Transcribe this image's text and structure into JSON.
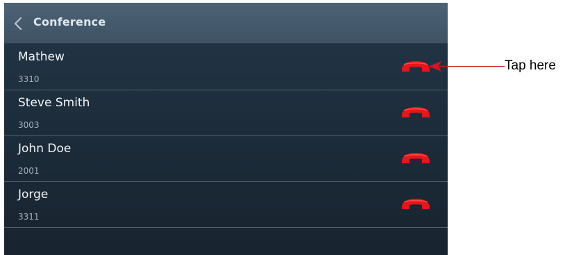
{
  "header": {
    "back_icon": "chevron-left-icon",
    "title": "Conference"
  },
  "participants": [
    {
      "name": "Mathew",
      "extension": "3310",
      "hangup_icon": "hang-up-phone-icon"
    },
    {
      "name": "Steve Smith",
      "extension": "3003",
      "hangup_icon": "hang-up-phone-icon"
    },
    {
      "name": "John Doe",
      "extension": "2001",
      "hangup_icon": "hang-up-phone-icon"
    },
    {
      "name": "Jorge",
      "extension": "3311",
      "hangup_icon": "hang-up-phone-icon"
    }
  ],
  "annotation": {
    "label": "Tap here",
    "color": "#d3181b"
  },
  "colors": {
    "hangup_red": "#e8151b",
    "header_bg": "#43586b",
    "list_bg": "#1f2f3e"
  }
}
